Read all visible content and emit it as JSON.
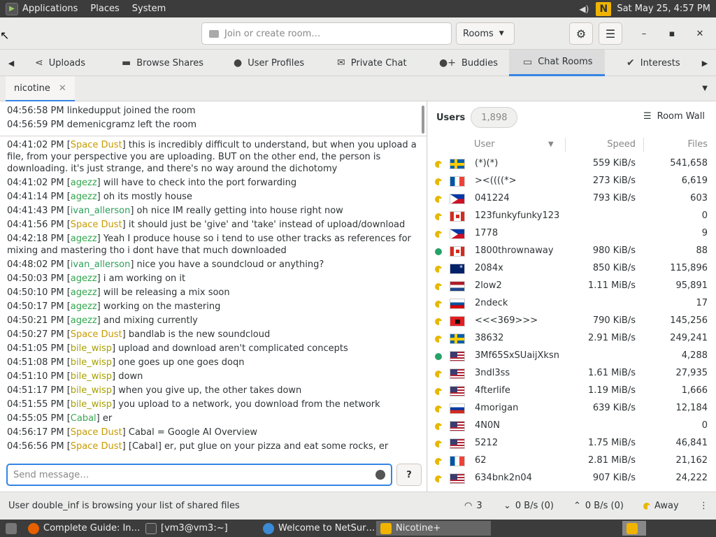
{
  "top_panel": {
    "menus": [
      "Applications",
      "Places",
      "System"
    ],
    "datetime": "Sat May 25,  4:57 PM"
  },
  "header": {
    "search_placeholder": "Join or create room…",
    "rooms_label": "Rooms"
  },
  "tabs": [
    {
      "label": "Uploads",
      "icon": "share-icon"
    },
    {
      "label": "Browse Shares",
      "icon": "folder-icon"
    },
    {
      "label": "User Profiles",
      "icon": "person-icon"
    },
    {
      "label": "Private Chat",
      "icon": "envelope-icon"
    },
    {
      "label": "Buddies",
      "icon": "add-user-icon"
    },
    {
      "label": "Chat Rooms",
      "icon": "chat-icon"
    },
    {
      "label": "Interests",
      "icon": "check-circle-icon"
    }
  ],
  "room_tab": {
    "label": "nicotine"
  },
  "status_log": [
    "04:56:58 PM linkedupput joined the room",
    "04:56:59 PM demenicgramz left the room"
  ],
  "messages": [
    {
      "time": "04:41:02 PM",
      "nick": "Space Dust",
      "color": "#c89b00",
      "text": " this is incredibly difficult to understand, but when you upload a file, from your perspective you are uploading. BUT on the other end, the person is downloading. it's just strange, and there's no way around the dichotomy"
    },
    {
      "time": "04:41:02 PM",
      "nick": "agezz",
      "color": "#2ea64a",
      "text": " will have to check into the port forwarding"
    },
    {
      "time": "04:41:14 PM",
      "nick": "agezz",
      "color": "#2ea64a",
      "text": " oh its mostly house"
    },
    {
      "time": "04:41:43 PM",
      "nick": "ivan_allerson",
      "color": "#2aa05a",
      "text": " oh nice IM really getting into house right now"
    },
    {
      "time": "04:41:56 PM",
      "nick": "Space Dust",
      "color": "#c89b00",
      "text": " it should just be 'give' and 'take' instead of upload/download"
    },
    {
      "time": "04:42:18 PM",
      "nick": "agezz",
      "color": "#2ea64a",
      "text": " Yeah I produce house so i tend to use other tracks as references for mixing and mastering tho i dont have that much downloaded"
    },
    {
      "time": "04:48:02 PM",
      "nick": "ivan_allerson",
      "color": "#2aa05a",
      "text": " nice you have a soundcloud or anything?"
    },
    {
      "time": "04:50:03 PM",
      "nick": "agezz",
      "color": "#2ea64a",
      "text": " i am working on it"
    },
    {
      "time": "04:50:10 PM",
      "nick": "agezz",
      "color": "#2ea64a",
      "text": " will be releasing a mix soon"
    },
    {
      "time": "04:50:17 PM",
      "nick": "agezz",
      "color": "#2ea64a",
      "text": " working on the mastering"
    },
    {
      "time": "04:50:21 PM",
      "nick": "agezz",
      "color": "#2ea64a",
      "text": " and mixing currently"
    },
    {
      "time": "04:50:27 PM",
      "nick": "Space Dust",
      "color": "#c89b00",
      "text": " bandlab is the new soundcloud"
    },
    {
      "time": "04:51:05 PM",
      "nick": "bile_wisp",
      "color": "#a8a000",
      "text": " upload and download aren't complicated concepts"
    },
    {
      "time": "04:51:08 PM",
      "nick": "bile_wisp",
      "color": "#a8a000",
      "text": " one goes up one goes doqn"
    },
    {
      "time": "04:51:10 PM",
      "nick": "bile_wisp",
      "color": "#a8a000",
      "text": " down"
    },
    {
      "time": "04:51:17 PM",
      "nick": "bile_wisp",
      "color": "#a8a000",
      "text": " when you give up, the other takes down"
    },
    {
      "time": "04:51:55 PM",
      "nick": "bile_wisp",
      "color": "#a8a000",
      "text": " you upload to a network, you download from the network"
    },
    {
      "time": "04:55:05 PM",
      "nick": "Cabal",
      "color": "#3aa850",
      "text": " er"
    },
    {
      "time": "04:56:17 PM",
      "nick": "Space Dust",
      "color": "#c89b00",
      "text": " Cabal = Google AI Overview"
    },
    {
      "time": "04:56:56 PM",
      "nick": "Space Dust",
      "color": "#c89b00",
      "text": " [Cabal] er, put glue on your pizza and eat some rocks, er"
    }
  ],
  "message_input": {
    "placeholder": "Send message…"
  },
  "users_panel": {
    "label": "Users",
    "count": "1,898",
    "room_wall": "Room Wall",
    "columns": {
      "user": "User",
      "speed": "Speed",
      "files": "Files"
    }
  },
  "users": [
    {
      "status": "away",
      "flag": "f-se",
      "name": "(*)(*)",
      "speed": "559 KiB/s",
      "files": "541,658"
    },
    {
      "status": "away",
      "flag": "f-fr",
      "name": "><((((*>",
      "speed": "273 KiB/s",
      "files": "6,619"
    },
    {
      "status": "away",
      "flag": "f-ph",
      "name": "041224",
      "speed": "793 KiB/s",
      "files": "603"
    },
    {
      "status": "away",
      "flag": "f-ca",
      "name": "123funkyfunky123",
      "speed": "",
      "files": "0"
    },
    {
      "status": "away",
      "flag": "f-ph",
      "name": "1778",
      "speed": "",
      "files": "9"
    },
    {
      "status": "online",
      "flag": "f-ca",
      "name": "1800thrownaway",
      "speed": "980 KiB/s",
      "files": "88"
    },
    {
      "status": "away",
      "flag": "f-au",
      "name": "2084x",
      "speed": "850 KiB/s",
      "files": "115,896"
    },
    {
      "status": "away",
      "flag": "f-nl",
      "name": "2low2",
      "speed": "1.11 MiB/s",
      "files": "95,891"
    },
    {
      "status": "away",
      "flag": "f-si",
      "name": "2ndeck",
      "speed": "",
      "files": "17"
    },
    {
      "status": "away",
      "flag": "f-al",
      "name": "<<<369>>>",
      "speed": "790 KiB/s",
      "files": "145,256"
    },
    {
      "status": "away",
      "flag": "f-se",
      "name": "38632",
      "speed": "2.91 MiB/s",
      "files": "249,241"
    },
    {
      "status": "online",
      "flag": "f-us",
      "name": "3Mf65SxSUaijXksn",
      "speed": "",
      "files": "4,288"
    },
    {
      "status": "away",
      "flag": "f-us",
      "name": "3ndl3ss",
      "speed": "1.61 MiB/s",
      "files": "27,935"
    },
    {
      "status": "away",
      "flag": "f-us",
      "name": "4fterlife",
      "speed": "1.19 MiB/s",
      "files": "1,666"
    },
    {
      "status": "away",
      "flag": "f-ru",
      "name": "4morigan",
      "speed": "639 KiB/s",
      "files": "12,184"
    },
    {
      "status": "away",
      "flag": "f-us",
      "name": "4N0N",
      "speed": "",
      "files": "0"
    },
    {
      "status": "away",
      "flag": "f-us",
      "name": "5212",
      "speed": "1.75 MiB/s",
      "files": "46,841"
    },
    {
      "status": "away",
      "flag": "f-fr",
      "name": "62",
      "speed": "2.81 MiB/s",
      "files": "21,162"
    },
    {
      "status": "away",
      "flag": "f-us",
      "name": "634bnk2n04",
      "speed": "907 KiB/s",
      "files": "24,222"
    }
  ],
  "statusbar": {
    "message": "User double_inf is browsing your list of shared files",
    "connections": "3",
    "download": "0 B/s (0)",
    "upload": "0 B/s (0)",
    "away": "Away"
  },
  "taskbar": [
    {
      "label": "Complete Guide: In…",
      "icon": "firefox-icon"
    },
    {
      "label": "[vm3@vm3:~]",
      "icon": "terminal-icon"
    },
    {
      "label": "Welcome to NetSur…",
      "icon": "netsurf-icon"
    },
    {
      "label": "Nicotine+",
      "icon": "nicotine-icon"
    }
  ]
}
